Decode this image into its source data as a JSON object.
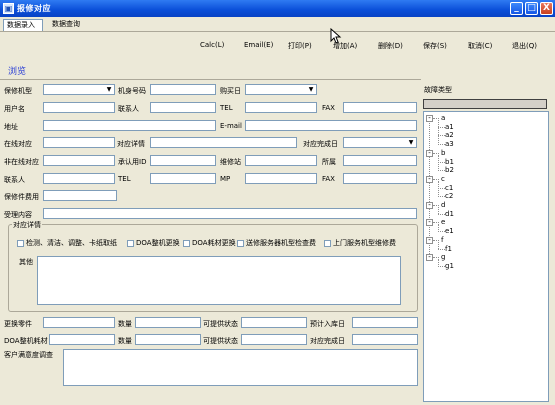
{
  "window": {
    "title": "报修对应",
    "buttons": [
      "_",
      "□",
      "X"
    ]
  },
  "tabs": [
    "数据录入",
    "数据查询"
  ],
  "toolbar": [
    "Calc(L)",
    "Email(E)",
    "打印(P)",
    "增加(A)",
    "删除(D)",
    "保存(S)",
    "取消(C)",
    "退出(Q)"
  ],
  "section_title": "浏览",
  "form": {
    "model": "保修机型",
    "serial": "机身号码",
    "purchase_date": "购买日",
    "username": "用户名",
    "contact": "联系人",
    "tel": "TEL",
    "fax": "FAX",
    "address": "地址",
    "email": "E-mail",
    "online": "在线对应",
    "detail": "对应详情",
    "finish_date": "对应完成日",
    "offline": "非在线对应",
    "user_id": "承认用ID",
    "repair_station": "维修站",
    "belong": "所属",
    "contact2": "联系人",
    "tel2": "TEL",
    "mp": "MP",
    "fax2": "FAX",
    "repair_fee": "保修件费用",
    "content": "受理内容"
  },
  "group": {
    "title": "对应详情",
    "options": [
      "检测、清洁、调整、卡纸取纸",
      "DOA整机更换",
      "DOA耗材更换",
      "送修服务器机型检查费",
      "上门服务机型维修费"
    ],
    "other": "其他"
  },
  "bottom": {
    "part": "更换零件",
    "qty": "数量",
    "supply": "可提供状态",
    "expected": "预计入库日",
    "doa": "DOA整机耗材",
    "qty2": "数量",
    "supply2": "可提供状态",
    "finish2": "对应完成日",
    "survey": "客户满意度调查"
  },
  "fault": {
    "label": "故障类型",
    "tree": [
      {
        "name": "a",
        "children": [
          "a1",
          "a2",
          "a3"
        ]
      },
      {
        "name": "b",
        "children": [
          "b1",
          "b2"
        ]
      },
      {
        "name": "c",
        "children": [
          "c1",
          "c2"
        ]
      },
      {
        "name": "d",
        "children": [
          "d1"
        ]
      },
      {
        "name": "e",
        "children": [
          "e1"
        ]
      },
      {
        "name": "f",
        "children": [
          "f1"
        ]
      },
      {
        "name": "g",
        "children": [
          "g1"
        ]
      }
    ]
  }
}
